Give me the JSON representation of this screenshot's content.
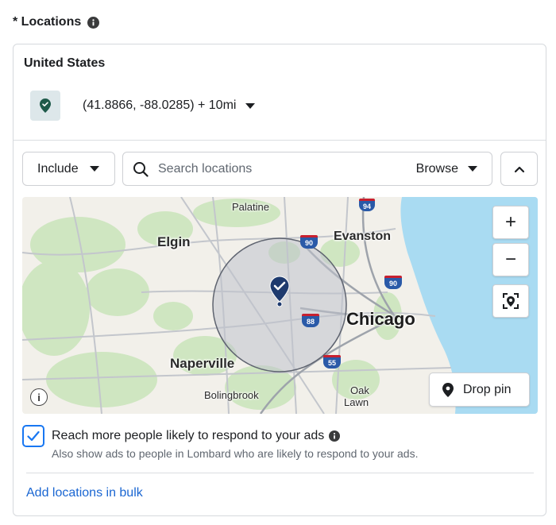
{
  "header": {
    "title": "* Locations",
    "info_icon": "info-icon"
  },
  "location_card": {
    "country": "United States",
    "selected_location": "(41.8866, -88.0285) + 10mi",
    "pin_icon": "location-pin-icon"
  },
  "controls": {
    "include_label": "Include",
    "search_placeholder": "Search locations",
    "browse_label": "Browse",
    "collapse_icon": "chevron-up-icon"
  },
  "map": {
    "labels": {
      "palatine": "Palatine",
      "elgin": "Elgin",
      "evanston": "Evanston",
      "chicago": "Chicago",
      "naperville": "Naperville",
      "bolingbrook": "Bolingbrook",
      "oak_lawn_1": "Oak",
      "oak_lawn_2": "Lawn"
    },
    "highway_shields": {
      "i94": "94",
      "i90_a": "90",
      "i90_b": "90",
      "i88": "88",
      "i55": "55"
    },
    "zoom_in": "+",
    "zoom_out": "−",
    "drop_pin_label": "Drop pin",
    "radius_mi": 10,
    "colors": {
      "water": "#a9dbf2",
      "land": "#f2f0ea",
      "green": "#cfe6c1",
      "radius_fill": "#bfc3cc",
      "radius_stroke": "#5f6470",
      "pin": "#1e3a6e"
    }
  },
  "reach": {
    "checked": true,
    "label": "Reach more people likely to respond to your ads",
    "description": "Also show ads to people in Lombard who are likely to respond to your ads."
  },
  "bulk_link": "Add locations in bulk",
  "colors": {
    "accent": "#1877f2",
    "link": "#1a66d2",
    "pin_badge_bg": "#dde7ea",
    "pin_badge_icon": "#1e5a4a"
  }
}
